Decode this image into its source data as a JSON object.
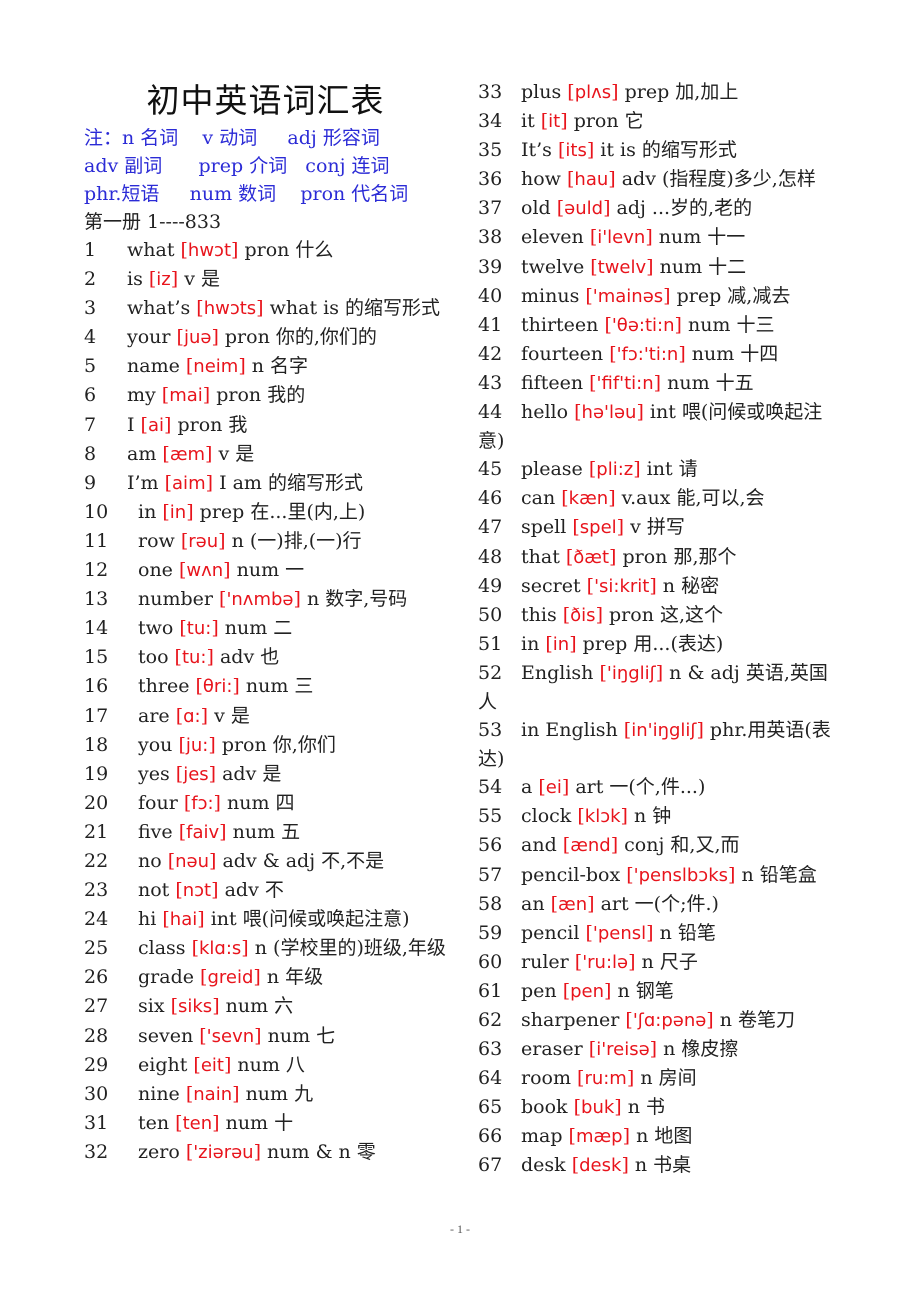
{
  "document": {
    "title": "初中英语词汇表",
    "note_lines": [
      "注：n 名词    v 动词     adj 形容词",
      "adv 副词      prep 介词   conj 连词",
      "phr.短语     num 数词    pron 代名词"
    ],
    "book_range": "第一册 1----833",
    "page_number": "- 1 -",
    "accent_colors": {
      "note": "#2b2bd6",
      "phonetic": "#e8141c",
      "text": "#222222"
    }
  },
  "left_entries": [
    {
      "n": "1",
      "word": "what",
      "ipa": "hwɔt",
      "def": "pron 什么"
    },
    {
      "n": "2",
      "word": "is",
      "ipa": "iz",
      "def": "v 是"
    },
    {
      "n": "3",
      "word": "what’s",
      "ipa": "hwɔts",
      "def": "what is 的缩写形式"
    },
    {
      "n": "4",
      "word": "your",
      "ipa": "juə",
      "def": "pron 你的,你们的"
    },
    {
      "n": "5",
      "word": "name",
      "ipa": "neim",
      "def": "n 名字"
    },
    {
      "n": "6",
      "word": "my",
      "ipa": "mai",
      "def": "pron 我的"
    },
    {
      "n": "7",
      "word": "I ",
      "ipa": "ai",
      "def": "pron 我"
    },
    {
      "n": "8",
      "word": "am",
      "ipa": "æm",
      "def": "v 是"
    },
    {
      "n": "9",
      "word": "I’m ",
      "ipa": "aim",
      "def": "  I am 的缩写形式"
    },
    {
      "n": "10",
      "word": "in",
      "ipa": "in",
      "def": "prep 在...里(内,上)"
    },
    {
      "n": "11",
      "word": "row",
      "ipa": "rəu",
      "def": "n (一)排,(一)行"
    },
    {
      "n": "12",
      "word": "one",
      "ipa": "wʌn",
      "def": "num 一"
    },
    {
      "n": "13",
      "word": "number",
      "ipa": "'nʌmbə",
      "def": "n 数字,号码"
    },
    {
      "n": "14",
      "word": "two",
      "ipa": "tu:",
      "def": "num 二"
    },
    {
      "n": "15",
      "word": "too",
      "ipa": "tu:",
      "def": "adv 也"
    },
    {
      "n": "16",
      "word": "three",
      "ipa": "θri:",
      "def": "num 三"
    },
    {
      "n": "17",
      "word": "are",
      "ipa": "ɑ:",
      "def": "v 是"
    },
    {
      "n": "18",
      "word": "you",
      "ipa": "ju:",
      "def": "pron 你,你们"
    },
    {
      "n": "19",
      "word": "yes",
      "ipa": "jes",
      "def": "adv 是"
    },
    {
      "n": "20",
      "word": "four",
      "ipa": "fɔ:",
      "def": "num 四"
    },
    {
      "n": "21",
      "word": "five",
      "ipa": "faiv",
      "def": "num 五"
    },
    {
      "n": "22",
      "word": "no",
      "ipa": "nəu",
      "def": "adv & adj 不,不是"
    },
    {
      "n": "23",
      "word": "not",
      "ipa": "nɔt",
      "def": "adv 不"
    },
    {
      "n": "24",
      "word": "hi",
      "ipa": "hai",
      "def": "int 喂(问候或唤起注意)"
    },
    {
      "n": "25",
      "word": "class",
      "ipa": "klɑ:s",
      "def": "n (学校里的)班级,年级"
    },
    {
      "n": "26",
      "word": "grade",
      "ipa": "greid",
      "def": "n 年级"
    },
    {
      "n": "27",
      "word": "six",
      "ipa": "siks",
      "def": "num 六"
    },
    {
      "n": "28",
      "word": "seven",
      "ipa": "'sevn",
      "def": "num 七"
    },
    {
      "n": "29",
      "word": "eight",
      "ipa": "eit",
      "def": "num 八"
    },
    {
      "n": "30",
      "word": "nine",
      "ipa": "nain",
      "def": "num 九"
    },
    {
      "n": "31",
      "word": "ten",
      "ipa": "ten",
      "def": "num 十"
    },
    {
      "n": "32",
      "word": "zero",
      "ipa": "'ziərəu",
      "def": "num & n 零"
    }
  ],
  "right_entries": [
    {
      "n": "33",
      "word": "plus",
      "ipa": "plʌs",
      "def": " prep  加,加上"
    },
    {
      "n": "34",
      "word": "it",
      "ipa": "it",
      "def": "pron 它"
    },
    {
      "n": "35",
      "word": "It’s",
      "ipa": "its",
      "def": "it is 的缩写形式"
    },
    {
      "n": "36",
      "word": "how",
      "ipa": "hau",
      "def": "adv (指程度)多少,怎样"
    },
    {
      "n": "37",
      "word": "old",
      "ipa": "əuld",
      "def": "adj ...岁的,老的"
    },
    {
      "n": "38",
      "word": "eleven",
      "ipa": "i'levn",
      "def": "num 十一"
    },
    {
      "n": "39",
      "word": "twelve",
      "ipa": "twelv",
      "def": "num 十二"
    },
    {
      "n": "40",
      "word": "minus",
      "ipa": "'mainəs",
      "def": "prep 减,减去"
    },
    {
      "n": "41",
      "word": "thirteen",
      "ipa": "'θə:ti:n",
      "def": "num 十三"
    },
    {
      "n": "42",
      "word": "fourteen",
      "ipa": "'fɔ:'ti:n",
      "def": "num 十四"
    },
    {
      "n": "43",
      "word": "fifteen",
      "ipa": "'fif'ti:n",
      "def": "num 十五"
    },
    {
      "n": "44",
      "word": "hello",
      "ipa": "hə'ləu",
      "def": "int 喂(问候或唤起注意)"
    },
    {
      "n": "45",
      "word": "please",
      "ipa": "pli:z",
      "def": "int 请"
    },
    {
      "n": "46",
      "word": "can",
      "ipa": "kæn",
      "def": "v.aux 能,可以,会"
    },
    {
      "n": "47",
      "word": "spell",
      "ipa": "spel",
      "def": "v  拼写"
    },
    {
      "n": "48",
      "word": "that",
      "ipa": "ðæt",
      "def": "pron 那,那个"
    },
    {
      "n": "49",
      "word": "secret",
      "ipa": "'si:krit",
      "def": "n 秘密"
    },
    {
      "n": "50",
      "word": "this",
      "ipa": "ðis",
      "def": "pron 这,这个"
    },
    {
      "n": "51",
      "word": "in",
      "ipa": "in",
      "def": "prep  用...(表达)"
    },
    {
      "n": "52",
      "word": "English",
      "ipa": "'iŋgliʃ",
      "def": "n & adj 英语,英国人"
    },
    {
      "n": "53",
      "word": "in English",
      "ipa": "in'iŋgliʃ",
      "def": " phr.用英语(表达)"
    },
    {
      "n": "54",
      "word": "a",
      "ipa": "ei",
      "def": "art  一(个,件...)"
    },
    {
      "n": "55",
      "word": "clock",
      "ipa": "klɔk",
      "def": "n 钟"
    },
    {
      "n": "56",
      "word": "and",
      "ipa": "ænd",
      "def": "conj 和,又,而"
    },
    {
      "n": "57",
      "word": "pencil-box",
      "ipa": "'penslbɔks",
      "def": "n 铅笔盒"
    },
    {
      "n": "58",
      "word": "an",
      "ipa": "æn",
      "def": "art  一(个;件.)"
    },
    {
      "n": "59",
      "word": "pencil",
      "ipa": "'pensl",
      "def": "n 铅笔"
    },
    {
      "n": "60",
      "word": "ruler",
      "ipa": "'ru:lə",
      "def": "n 尺子"
    },
    {
      "n": "61",
      "word": "pen",
      "ipa": "pen",
      "def": "n 钢笔"
    },
    {
      "n": "62",
      "word": "sharpener",
      "ipa": "'ʃɑ:pənə",
      "def": "n 卷笔刀"
    },
    {
      "n": "63",
      "word": "eraser",
      "ipa": "i'reisə",
      "def": "n 橡皮擦"
    },
    {
      "n": "64",
      "word": "room",
      "ipa": "ru:m",
      "def": "n 房间"
    },
    {
      "n": "65",
      "word": "book",
      "ipa": "buk",
      "def": "n 书"
    },
    {
      "n": "66",
      "word": "map",
      "ipa": "mæp",
      "def": "n 地图"
    },
    {
      "n": "67",
      "word": "desk",
      "ipa": "desk",
      "def": "n 书桌"
    }
  ]
}
